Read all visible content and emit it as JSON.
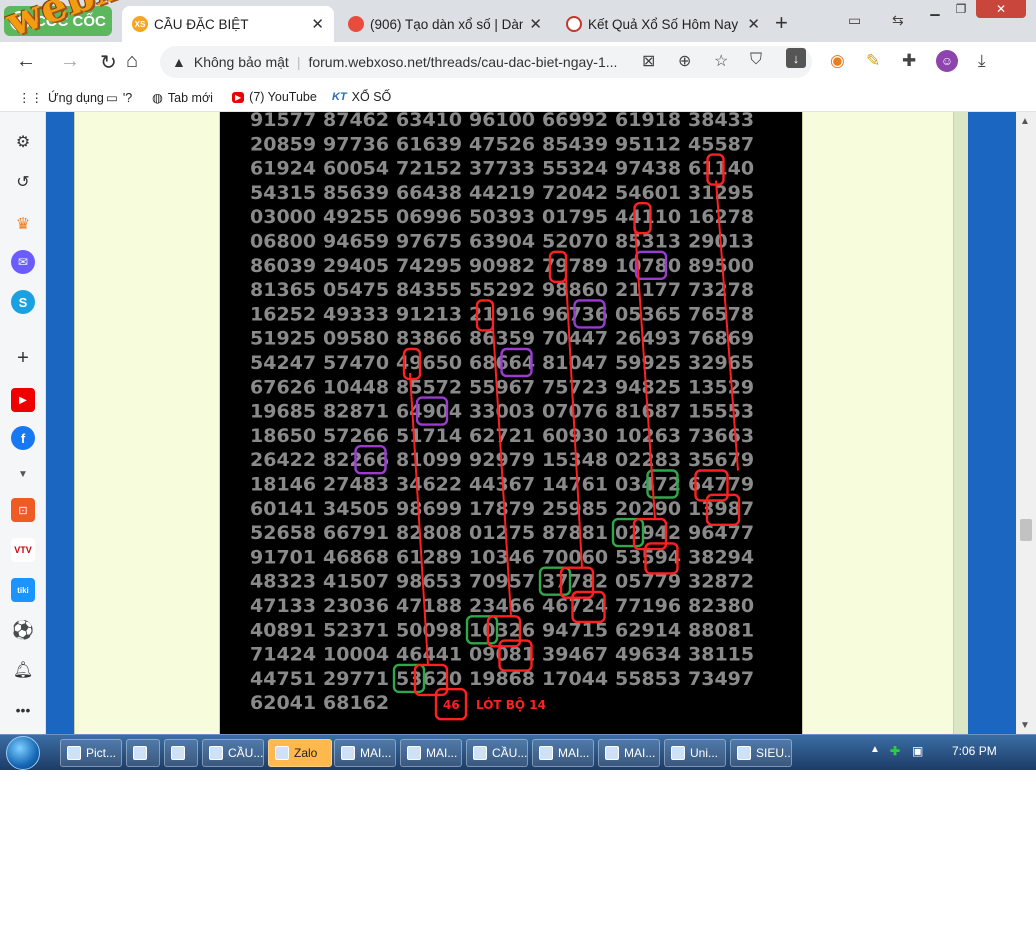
{
  "browser": {
    "brand_label": "CỐC CỐC",
    "tabs": [
      {
        "title": "CẦU ĐẶC BIỆT",
        "badge": "XS",
        "color": "#f5a623",
        "active": true
      },
      {
        "title": "(906) Tạo dàn xổ số | Dàn",
        "badge": "",
        "color": "#e74c3c",
        "active": false
      },
      {
        "title": "Kết Quả Xổ Số Hôm Nay",
        "badge": "",
        "color": "#c0392b",
        "active": false
      }
    ],
    "new_tab_label": "+",
    "close_label": "✕"
  },
  "address_bar": {
    "security_label": "Không bảo mật",
    "url": "forum.webxoso.net/threads/cau-dac-biet-ngay-1..."
  },
  "bookmarks": {
    "items": [
      {
        "label": "Ứng dụng",
        "icon": "apps-grid-icon"
      },
      {
        "label": "'?",
        "icon": "folder-icon"
      },
      {
        "label": "Tab mới",
        "icon": "globe-icon"
      },
      {
        "label": "(7) YouTube",
        "icon": "youtube-icon"
      },
      {
        "label": "XỔ SỐ",
        "icon": "kt-icon"
      }
    ]
  },
  "watermark": "webxoso.net",
  "board": {
    "rows": [
      [
        "91577",
        "87462",
        "63410",
        "96100",
        "66992",
        "61918",
        "38433"
      ],
      [
        "20859",
        "97736",
        "61639",
        "47526",
        "85439",
        "95112",
        "45587"
      ],
      [
        "61924",
        "60054",
        "72152",
        "37733",
        "55324",
        "97438",
        "61140"
      ],
      [
        "54315",
        "85639",
        "66438",
        "44219",
        "72042",
        "54601",
        "31295"
      ],
      [
        "03000",
        "49255",
        "06996",
        "50393",
        "01795",
        "44110",
        "16278"
      ],
      [
        "06800",
        "94659",
        "97675",
        "63904",
        "52070",
        "85313",
        "29013"
      ],
      [
        "86039",
        "29405",
        "74295",
        "90982",
        "79789",
        "10780",
        "89500"
      ],
      [
        "81365",
        "05475",
        "84355",
        "55292",
        "98860",
        "21177",
        "73278"
      ],
      [
        "16252",
        "49333",
        "91213",
        "21916",
        "96736",
        "05365",
        "76578"
      ],
      [
        "51925",
        "09580",
        "83866",
        "86359",
        "70447",
        "26493",
        "76869"
      ],
      [
        "54247",
        "57470",
        "49650",
        "68664",
        "81047",
        "59925",
        "32965"
      ],
      [
        "67626",
        "10448",
        "85572",
        "55967",
        "75723",
        "94825",
        "13529"
      ],
      [
        "19685",
        "82871",
        "64904",
        "33003",
        "07076",
        "81687",
        "15553"
      ],
      [
        "18650",
        "57266",
        "51714",
        "62721",
        "60930",
        "10263",
        "73663"
      ],
      [
        "26422",
        "82266",
        "81099",
        "92979",
        "15348",
        "02283",
        "35679"
      ],
      [
        "18146",
        "27483",
        "34622",
        "44367",
        "14761",
        "03472",
        "64779"
      ],
      [
        "60141",
        "34505",
        "98699",
        "17879",
        "25985",
        "20290",
        "13987"
      ],
      [
        "52658",
        "66791",
        "82808",
        "01275",
        "87881",
        "02942",
        "96477"
      ],
      [
        "91701",
        "46868",
        "61289",
        "10346",
        "70060",
        "53594",
        "38294"
      ],
      [
        "48323",
        "41507",
        "98653",
        "70957",
        "37782",
        "05779",
        "32872"
      ],
      [
        "47133",
        "23036",
        "47188",
        "23466",
        "46724",
        "77196",
        "82380"
      ],
      [
        "40891",
        "52371",
        "50098",
        "10326",
        "94715",
        "62914",
        "88081"
      ],
      [
        "71424",
        "10004",
        "46441",
        "09081",
        "39467",
        "49634",
        "38115"
      ],
      [
        "44751",
        "29771",
        "53620",
        "19868",
        "17044",
        "55853",
        "73497"
      ],
      [
        "62041",
        "68162"
      ]
    ],
    "result_number": "46",
    "result_label": "LÓT BỘ 14",
    "colors": {
      "number": "#8a8a8a",
      "red": "#ff2020",
      "green": "#2ea84a",
      "purple": "#9b3bd0"
    }
  },
  "taskbar": {
    "tasks": [
      {
        "label": "Pict..."
      },
      {
        "label": ""
      },
      {
        "label": ""
      },
      {
        "label": "CẦU..."
      },
      {
        "label": "Zalo"
      },
      {
        "label": "MAI..."
      },
      {
        "label": "MAI..."
      },
      {
        "label": "CẦU..."
      },
      {
        "label": "MAI..."
      },
      {
        "label": "MAI..."
      },
      {
        "label": "Uni..."
      },
      {
        "label": "SIEU..."
      }
    ],
    "clock": "7:06 PM"
  }
}
